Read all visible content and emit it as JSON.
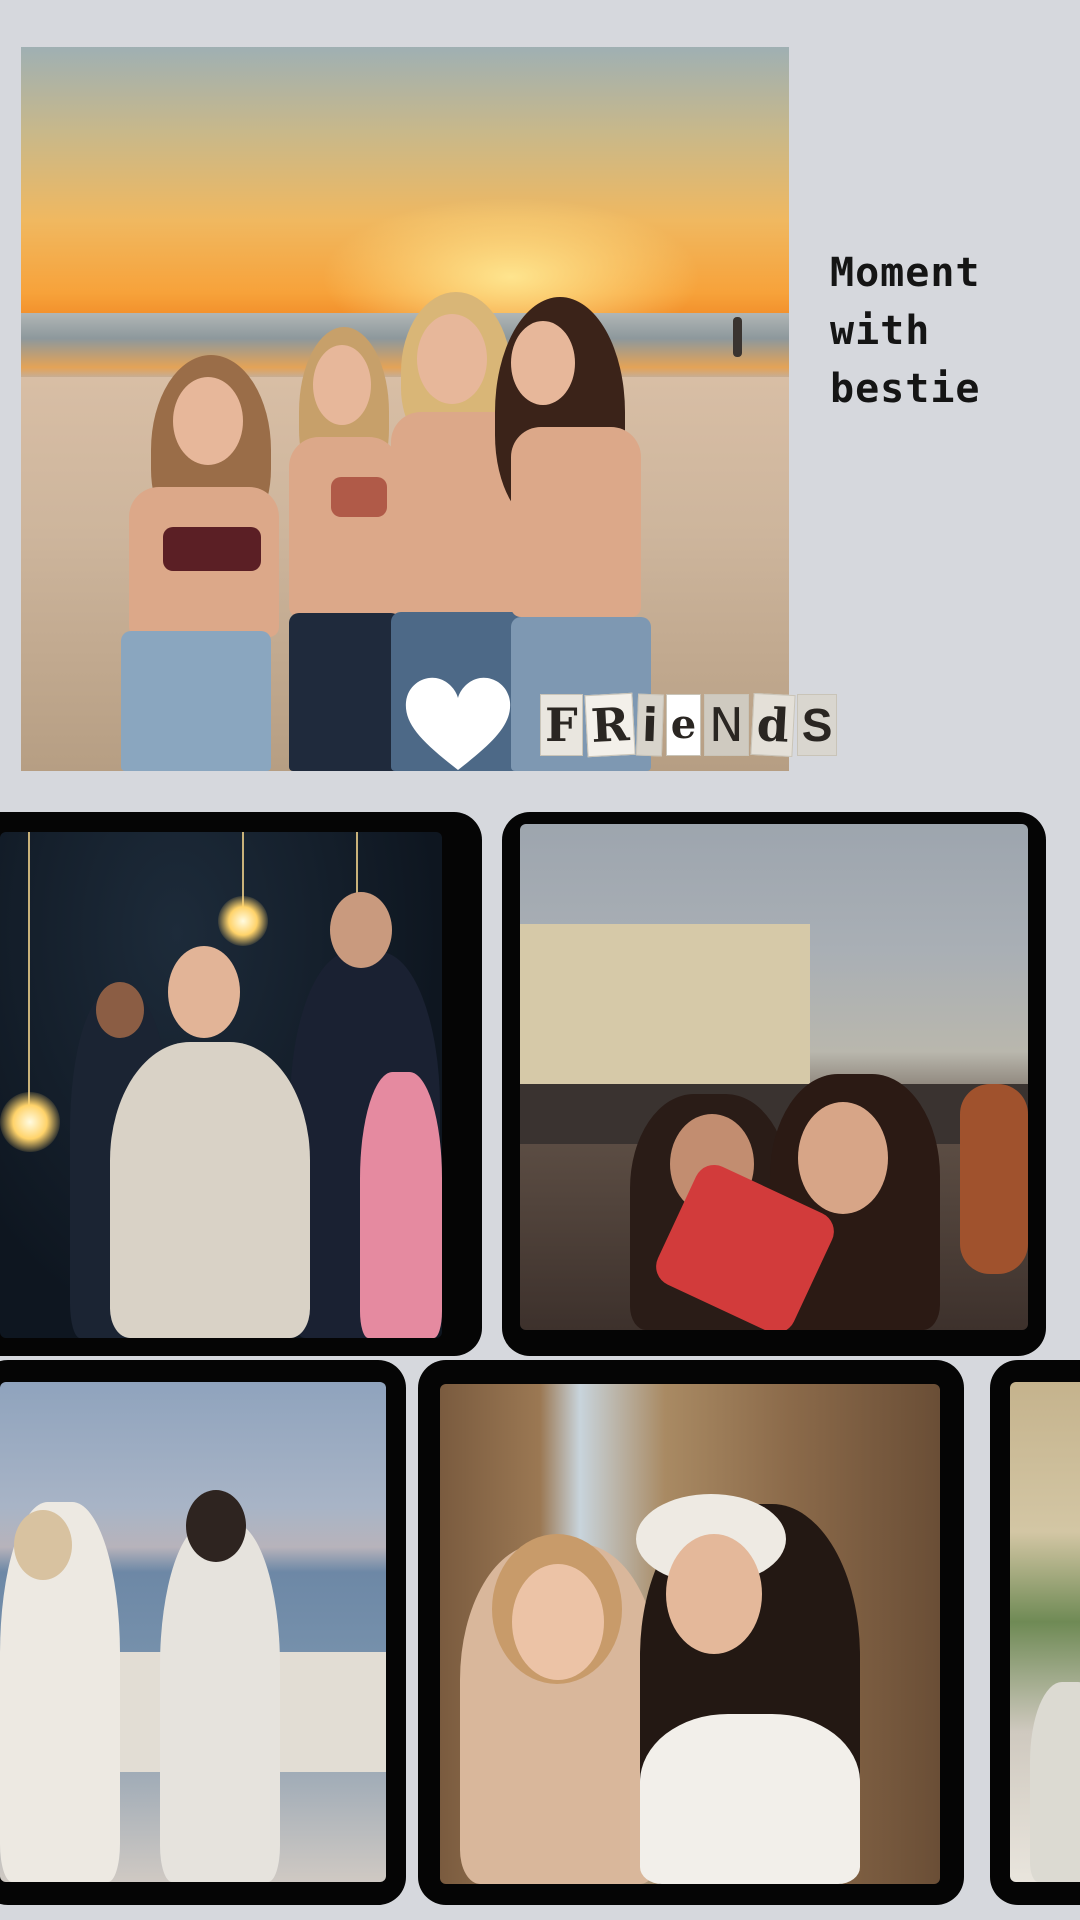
{
  "caption": {
    "line1": "Moment",
    "line2": "with",
    "line3": "bestie"
  },
  "sticker": {
    "letters": [
      "F",
      "R",
      "i",
      "e",
      "N",
      "d",
      "S"
    ]
  },
  "colors": {
    "background": "#d6d8dd",
    "frame": "#050505",
    "heart": "#ffffff"
  },
  "photos": {
    "hero": "sunset-beach-friends",
    "party": "night-party-lights",
    "car": "convertible-car-selfie",
    "sea": "seaside-evening-dresses",
    "selfie": "tower-selfie",
    "edge": "beach-resort-partial"
  }
}
